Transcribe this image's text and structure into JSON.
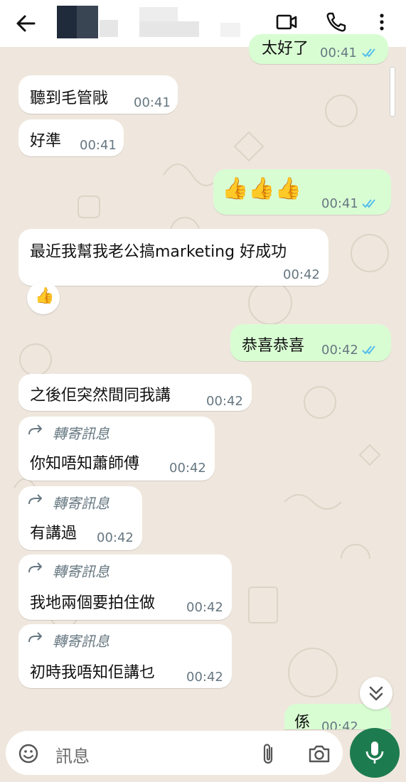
{
  "header": {
    "back_icon": "arrow-left-icon",
    "video_icon": "video-call-icon",
    "phone_icon": "phone-icon",
    "menu_icon": "more-vertical-icon"
  },
  "messages": {
    "m0": {
      "text": "太好了",
      "time": "00:41"
    },
    "m1": {
      "text": "聽到毛管戙",
      "time": "00:41"
    },
    "m2": {
      "text": "好準",
      "time": "00:41"
    },
    "m3": {
      "text": "👍👍👍",
      "time": "00:41"
    },
    "m4": {
      "text": "最近我幫我老公搞marketing 好成功",
      "time": "00:42",
      "reaction": "👍"
    },
    "m5": {
      "text": "恭喜恭喜",
      "time": "00:42"
    },
    "m6": {
      "text": "之後佢突然間同我講",
      "time": "00:42"
    },
    "m7": {
      "forwarded": "轉寄訊息",
      "text": "你知唔知蕭師傅",
      "time": "00:42"
    },
    "m8": {
      "forwarded": "轉寄訊息",
      "text": "有講過",
      "time": "00:42"
    },
    "m9": {
      "forwarded": "轉寄訊息",
      "text": "我地兩個要拍住做",
      "time": "00:42"
    },
    "m10": {
      "forwarded": "轉寄訊息",
      "text": "初時我唔知佢講乜",
      "time": "00:42"
    },
    "m11": {
      "text": "係",
      "time": "00:42"
    }
  },
  "input": {
    "placeholder": "訊息",
    "emoji_icon": "emoji-icon",
    "attach_icon": "paperclip-icon",
    "camera_icon": "camera-icon",
    "mic_icon": "microphone-icon"
  },
  "colors": {
    "incoming_bubble": "#ffffff",
    "outgoing_bubble": "#d9fdd3",
    "read_ticks": "#53bdeb",
    "mic_button": "#1d7c4f",
    "wallpaper": "#efe7dd"
  }
}
